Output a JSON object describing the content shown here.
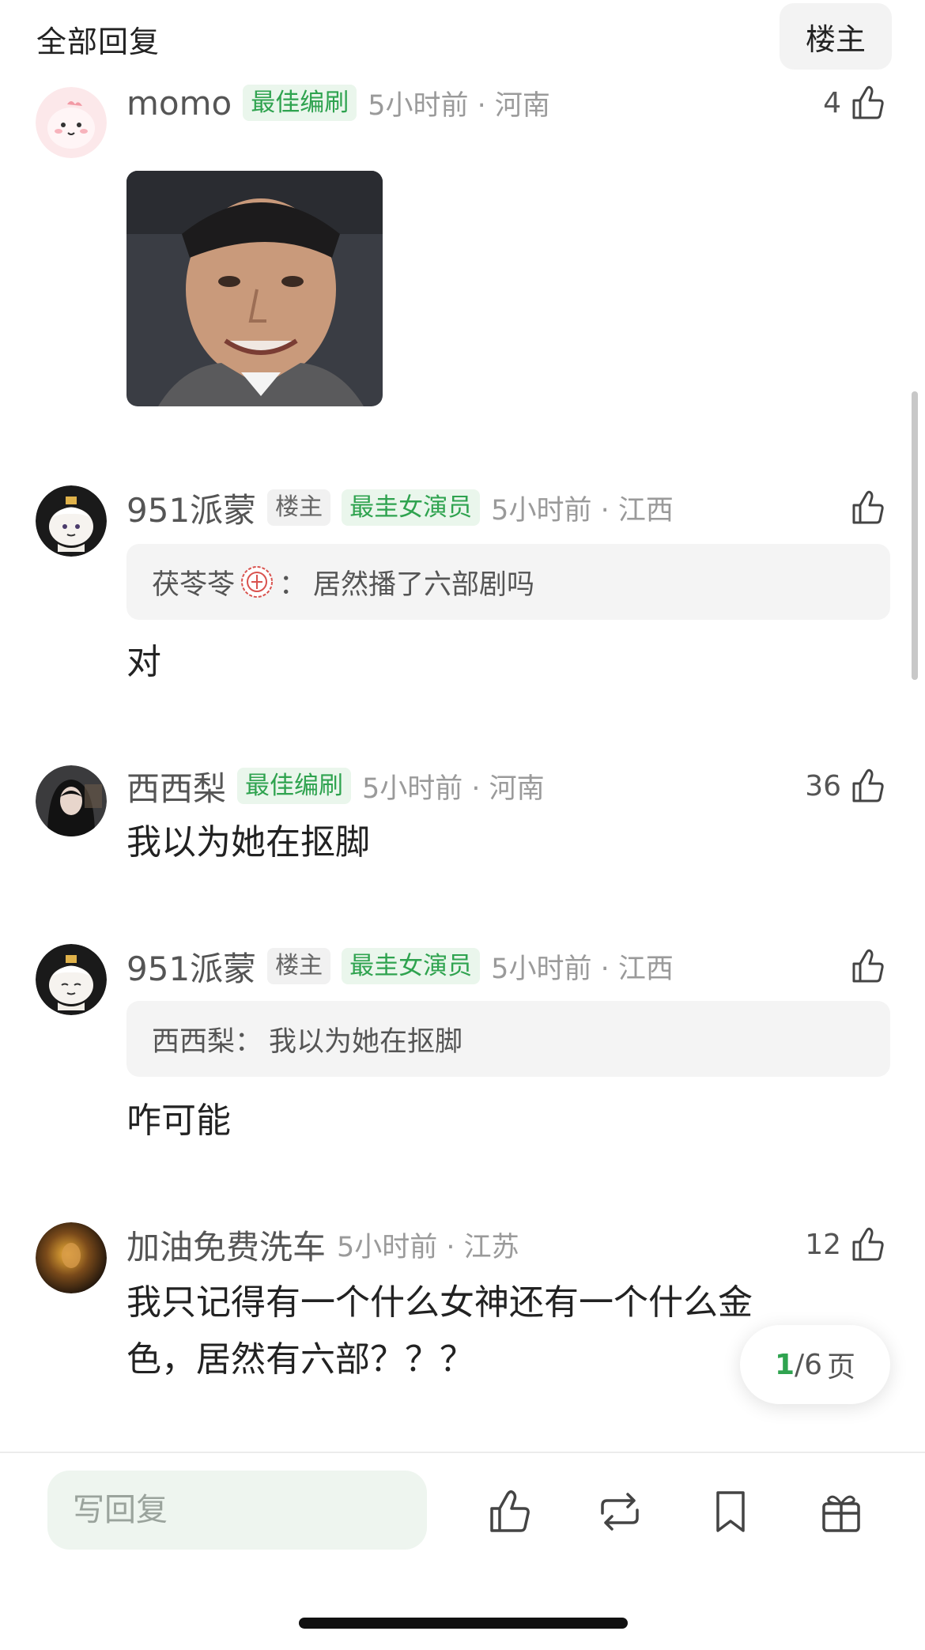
{
  "header": {
    "title": "全部回复",
    "owner_button": "楼主"
  },
  "comments": [
    {
      "username": "momo",
      "tags": [
        "最佳编刷"
      ],
      "time": "5小时前 · 河南",
      "likes": "4",
      "has_image": true
    },
    {
      "username": "951派蒙",
      "owner_tag": "楼主",
      "tags": [
        "最圭女演员"
      ],
      "time": "5小时前 · 江西",
      "likes": "",
      "quote": {
        "author": "茯苓苓",
        "sep": "：",
        "text": "居然播了六部剧吗"
      },
      "text": "对"
    },
    {
      "username": "西西梨",
      "tags": [
        "最佳编刷"
      ],
      "time": "5小时前 · 河南",
      "likes": "36",
      "text": "我以为她在抠脚"
    },
    {
      "username": "951派蒙",
      "owner_tag": "楼主",
      "tags": [
        "最圭女演员"
      ],
      "time": "5小时前 · 江西",
      "likes": "",
      "quote": {
        "author": "西西梨",
        "sep": "：",
        "text": "我以为她在抠脚"
      },
      "text": "咋可能"
    },
    {
      "username": "加油免费洗车",
      "time": "5小时前 · 江苏",
      "likes": "12",
      "text_line1": "我只记得有一个什么女神还有一个什么金",
      "text_line2": "色，居然有六部？？？"
    }
  ],
  "pager": {
    "current": "1",
    "total": "/6",
    "unit": "页"
  },
  "bottom_bar": {
    "reply_placeholder": "写回复",
    "icons": [
      "like-icon",
      "repost-icon",
      "bookmark-icon",
      "gift-icon"
    ]
  },
  "colors": {
    "accent_green": "#2fa34f",
    "tag_bg": "#eaf6ec",
    "input_bg": "#eef5ef"
  }
}
